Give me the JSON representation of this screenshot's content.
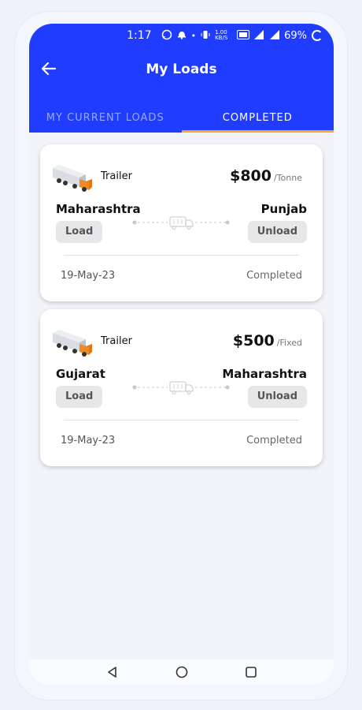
{
  "status_bar": {
    "time": "1:17",
    "battery": "69%",
    "net_speed": "1.00 KB/S"
  },
  "header": {
    "title": "My Loads"
  },
  "tabs": [
    {
      "label": "MY CURRENT LOADS",
      "active": false
    },
    {
      "label": "COMPLETED",
      "active": true
    }
  ],
  "loads": [
    {
      "vehicle": "Trailer",
      "price": "$800",
      "unit": "/Tonne",
      "from": "Maharashtra",
      "to": "Punjab",
      "load_label": "Load",
      "unload_label": "Unload",
      "date": "19-May-23",
      "status": "Completed"
    },
    {
      "vehicle": "Trailer",
      "price": "$500",
      "unit": "/Fixed",
      "from": "Gujarat",
      "to": "Maharashtra",
      "load_label": "Load",
      "unload_label": "Unload",
      "date": "19-May-23",
      "status": "Completed"
    }
  ],
  "colors": {
    "primary": "#1f3cff",
    "tab_indicator": "#f4a622",
    "chip_bg": "#e7e7ea"
  }
}
